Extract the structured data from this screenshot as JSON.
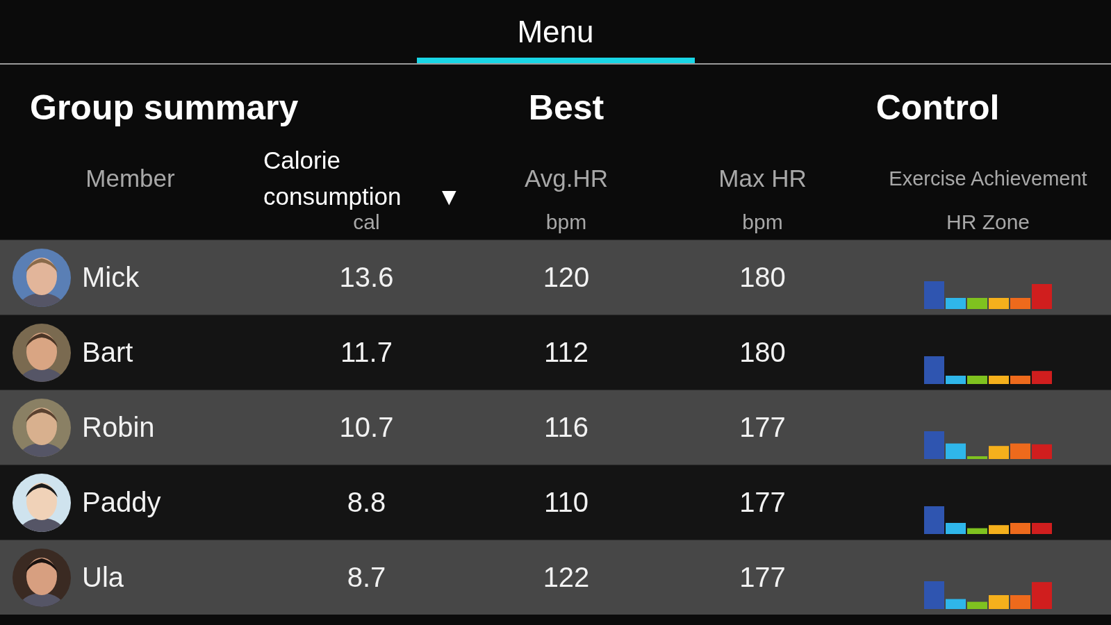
{
  "tabs": [
    {
      "label": "Menu",
      "selected": true
    }
  ],
  "sections": [
    "Group summary",
    "Best",
    "Control"
  ],
  "columns": [
    {
      "label": "Member"
    },
    {
      "label": "Calorie consumption",
      "sort_indicator": "▼",
      "unit": "cal"
    },
    {
      "label": "Avg.HR",
      "unit": "bpm"
    },
    {
      "label": "Max HR",
      "unit": "bpm"
    },
    {
      "label": "Exercise Achievement",
      "unit": "HR Zone"
    }
  ],
  "rows": [
    {
      "name": "Mick",
      "calorie": "13.6",
      "avg_hr": "120",
      "max_hr": "180"
    },
    {
      "name": "Bart",
      "calorie": "11.7",
      "avg_hr": "112",
      "max_hr": "180"
    },
    {
      "name": "Robin",
      "calorie": "10.7",
      "avg_hr": "116",
      "max_hr": "177"
    },
    {
      "name": "Paddy",
      "calorie": "8.8",
      "avg_hr": "110",
      "max_hr": "177"
    },
    {
      "name": "Ula",
      "calorie": "8.7",
      "avg_hr": "122",
      "max_hr": "177"
    }
  ]
}
